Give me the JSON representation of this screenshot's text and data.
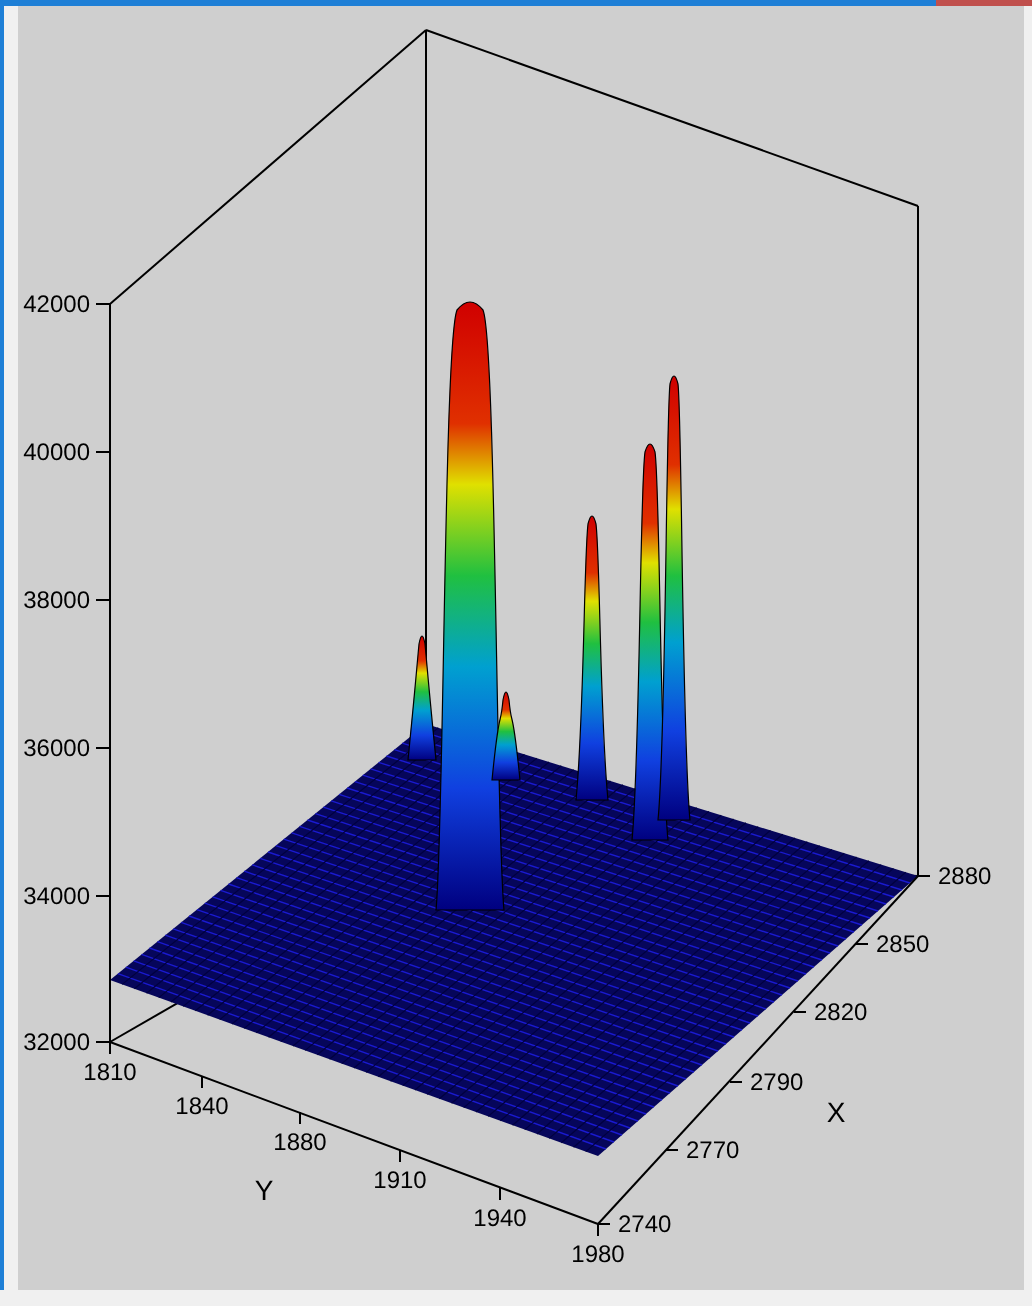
{
  "plot": {
    "z_ticks": [
      "42000",
      "40000",
      "38000",
      "36000",
      "34000",
      "32000"
    ],
    "y_ticks": [
      "1810",
      "1840",
      "1880",
      "1910",
      "1940",
      "1980"
    ],
    "x_ticks": [
      "2740",
      "2770",
      "2790",
      "2820",
      "2850",
      "2880"
    ],
    "x_label": "X",
    "y_label": "Y"
  }
}
